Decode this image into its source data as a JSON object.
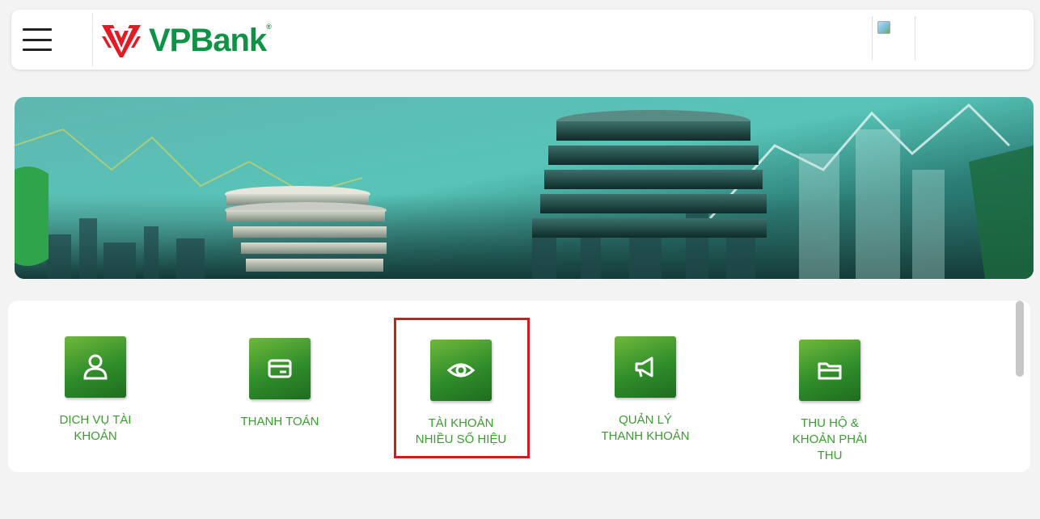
{
  "header": {
    "menu_icon": "hamburger-menu-icon",
    "brand": "VPBank",
    "brand_reg": "®",
    "avatar_icon": "broken-image-icon",
    "colors": {
      "brand_green": "#0c9444",
      "brand_red": "#e21c24"
    }
  },
  "banner": {
    "image": "coin-stacks-finance-banner"
  },
  "services": [
    {
      "label": "DỊCH VỤ TÀI\nKHOẢN",
      "icon": "user-icon"
    },
    {
      "label": "THANH TOÁN",
      "icon": "card-icon"
    },
    {
      "label": "TÀI KHOẢN\nNHIỀU SỐ HIỆU",
      "icon": "eye-icon",
      "highlighted": true
    },
    {
      "label": "QUẢN LÝ\nTHANH KHOẢN",
      "icon": "megaphone-icon"
    },
    {
      "label": "THU HỘ &\nKHOẢN PHẢI\nTHU",
      "icon": "folder-icon"
    }
  ],
  "colors": {
    "tile_green": "#3a9d2e",
    "highlight": "#d01c1c",
    "background": "#f3f3f3"
  }
}
